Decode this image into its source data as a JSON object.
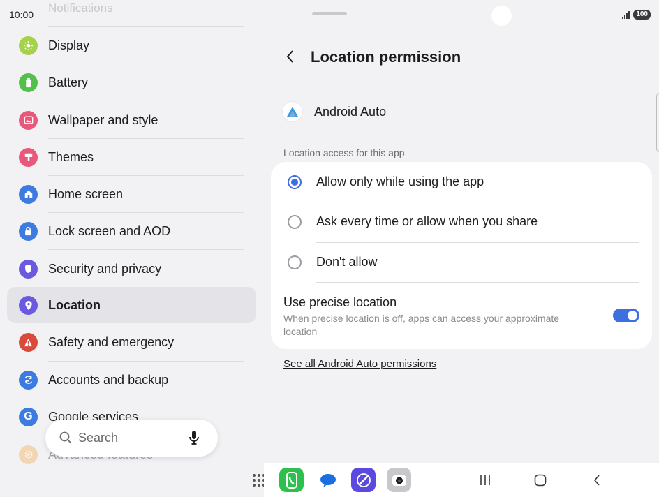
{
  "status_bar": {
    "time": "10:00",
    "battery": "100"
  },
  "left_list": {
    "faded_top_item": "Notifications",
    "items": [
      {
        "label": "Display",
        "icon": "sun-icon",
        "color": "#a4d24a"
      },
      {
        "label": "Battery",
        "icon": "battery-icon",
        "color": "#52c04a"
      },
      {
        "label": "Wallpaper and style",
        "icon": "wallpaper-icon",
        "color": "#e8587a"
      },
      {
        "label": "Themes",
        "icon": "brush-icon",
        "color": "#e8587a"
      },
      {
        "label": "Home screen",
        "icon": "home-icon",
        "color": "#3e7be0"
      },
      {
        "label": "Lock screen and AOD",
        "icon": "lock-icon",
        "color": "#3e7be0"
      },
      {
        "label": "Security and privacy",
        "icon": "shield-icon",
        "color": "#6a5ae0"
      },
      {
        "label": "Location",
        "icon": "location-pin-icon",
        "color": "#6a5ae0",
        "selected": true
      },
      {
        "label": "Safety and emergency",
        "icon": "alert-icon",
        "color": "#d84a3a"
      },
      {
        "label": "Accounts and backup",
        "icon": "sync-icon",
        "color": "#3e7be0"
      },
      {
        "label": "Google services",
        "icon": "google-icon",
        "color": "#3e7be0"
      },
      {
        "label": "Advanced features",
        "icon": "gear-icon",
        "color": "#f2a23a"
      }
    ],
    "search": {
      "label": "Search"
    }
  },
  "detail": {
    "title": "Location permission",
    "app_name": "Android Auto",
    "section_label": "Location access for this app",
    "options": [
      {
        "label": "Allow only while using the app",
        "selected": true
      },
      {
        "label": "Ask every time or allow when you share",
        "selected": false
      },
      {
        "label": "Don't allow",
        "selected": false
      }
    ],
    "precise": {
      "title": "Use precise location",
      "subtitle": "When precise location is off, apps can access your approximate location",
      "enabled": true
    },
    "see_all_link": "See all Android Auto permissions"
  },
  "accent_color": "#3e6fe0"
}
